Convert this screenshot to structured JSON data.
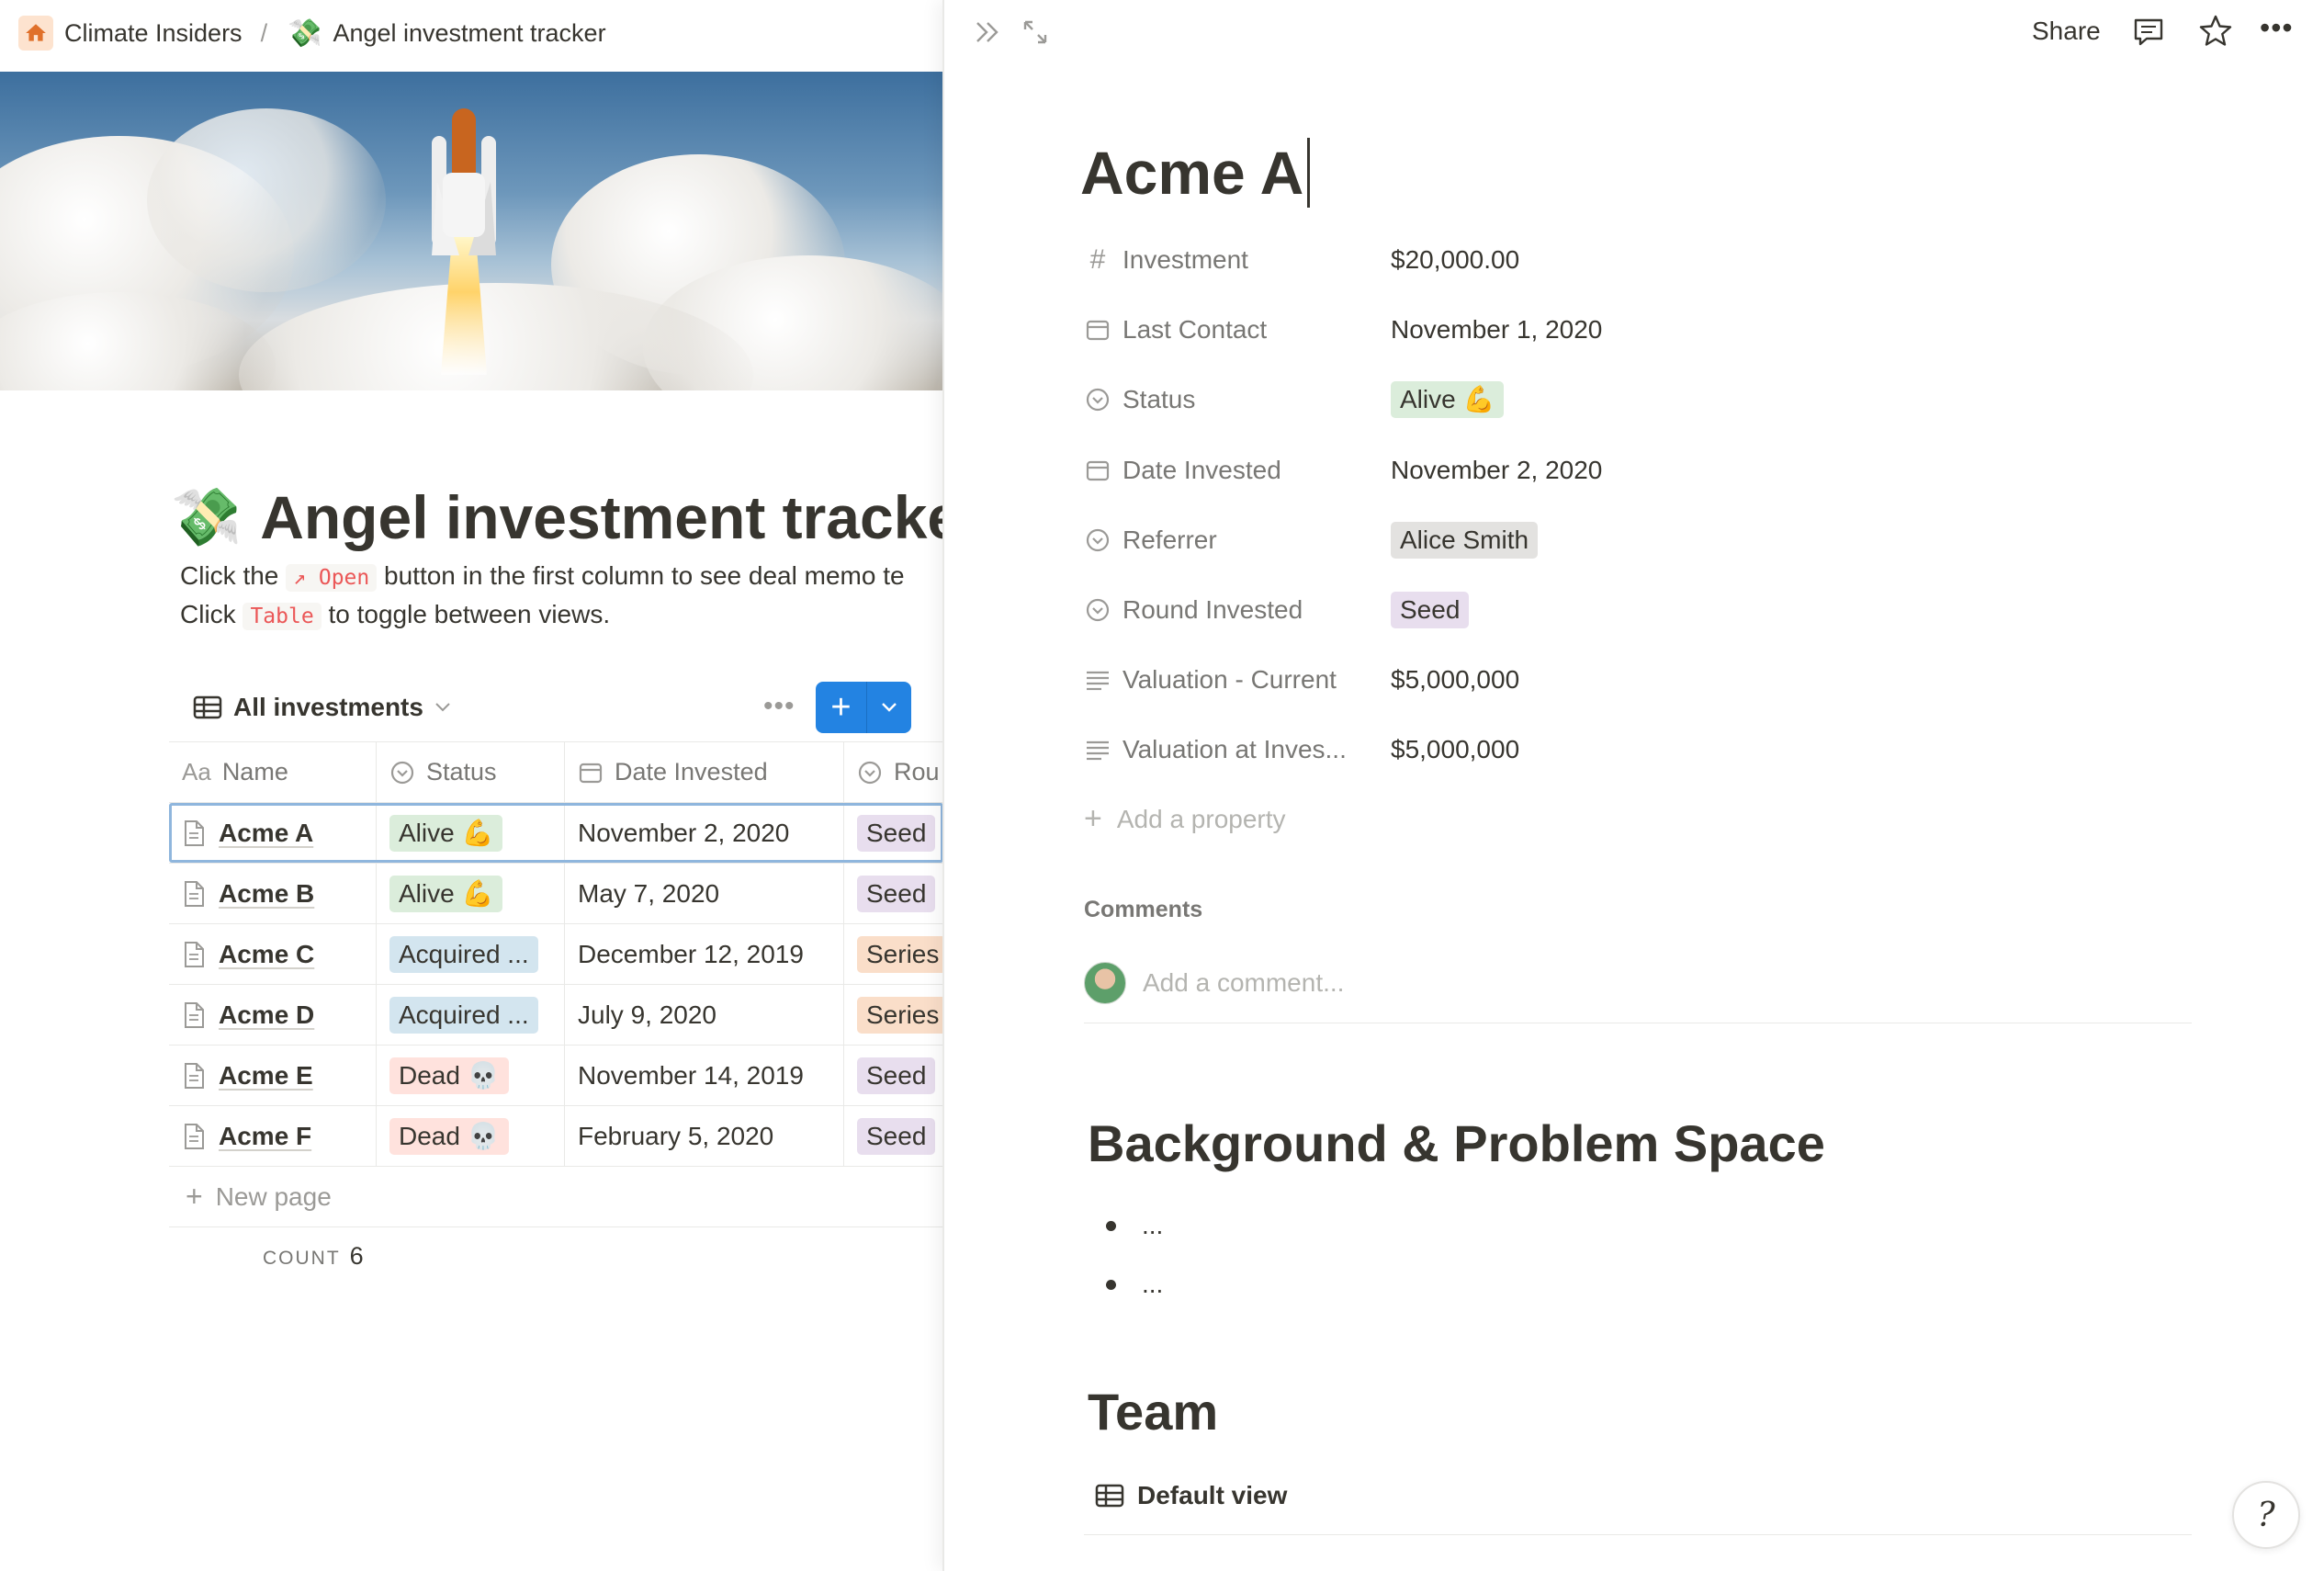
{
  "breadcrumb": {
    "workspace": "Climate Insiders",
    "separator": "/",
    "page": "Angel investment tracker"
  },
  "left_page": {
    "title": "Angel investment tracker",
    "desc_line1_a": "Click the",
    "desc_line1_code": "↗ Open",
    "desc_line1_b": "button in the first column to see deal memo te",
    "desc_line2_a": "Click",
    "desc_line2_code": "Table",
    "desc_line2_b": "to toggle between views.",
    "view_name": "All investments",
    "table": {
      "columns": [
        "Name",
        "Status",
        "Date Invested",
        "Rou"
      ],
      "rows": [
        {
          "name": "Acme A",
          "status": "Alive 💪",
          "status_type": "alive",
          "date": "November 2, 2020",
          "round": "Seed",
          "round_type": "seed"
        },
        {
          "name": "Acme B",
          "status": "Alive 💪",
          "status_type": "alive",
          "date": "May 7, 2020",
          "round": "Seed",
          "round_type": "seed"
        },
        {
          "name": "Acme C",
          "status": "Acquired ...",
          "status_type": "acquired",
          "date": "December 12, 2019",
          "round": "Series",
          "round_type": "series"
        },
        {
          "name": "Acme D",
          "status": "Acquired ...",
          "status_type": "acquired",
          "date": "July 9, 2020",
          "round": "Series",
          "round_type": "series"
        },
        {
          "name": "Acme E",
          "status": "Dead 💀",
          "status_type": "dead",
          "date": "November 14, 2019",
          "round": "Seed",
          "round_type": "seed"
        },
        {
          "name": "Acme F",
          "status": "Dead 💀",
          "status_type": "dead",
          "date": "February 5, 2020",
          "round": "Seed",
          "round_type": "seed"
        }
      ],
      "new_page_label": "New page",
      "count_label": "COUNT",
      "count_value": "6"
    }
  },
  "right_page": {
    "share_label": "Share",
    "title": "Acme A",
    "properties": [
      {
        "icon": "number-icon",
        "label": "Investment",
        "value": "$20,000.00",
        "kind": "text"
      },
      {
        "icon": "calendar-icon",
        "label": "Last Contact",
        "value": "November 1, 2020",
        "kind": "text"
      },
      {
        "icon": "select-icon",
        "label": "Status",
        "value": "Alive 💪",
        "kind": "tag",
        "tag": "alive"
      },
      {
        "icon": "calendar-icon",
        "label": "Date Invested",
        "value": "November 2, 2020",
        "kind": "text"
      },
      {
        "icon": "select-icon",
        "label": "Referrer",
        "value": "Alice Smith",
        "kind": "tag",
        "tag": "gray"
      },
      {
        "icon": "select-icon",
        "label": "Round Invested",
        "value": "Seed",
        "kind": "tag",
        "tag": "seed"
      },
      {
        "icon": "text-icon",
        "label": "Valuation - Current",
        "value": "$5,000,000",
        "kind": "text"
      },
      {
        "icon": "text-icon",
        "label": "Valuation at Inves...",
        "value": "$5,000,000",
        "kind": "text"
      }
    ],
    "add_property_label": "Add a property",
    "comments_heading": "Comments",
    "comment_placeholder": "Add a comment...",
    "section1_heading": "Background & Problem Space",
    "bullets": [
      "...",
      "..."
    ],
    "section2_heading": "Team",
    "default_view_label": "Default view"
  },
  "colors": {
    "accent": "#2383e2",
    "text": "#37352f",
    "muted": "#787774"
  }
}
